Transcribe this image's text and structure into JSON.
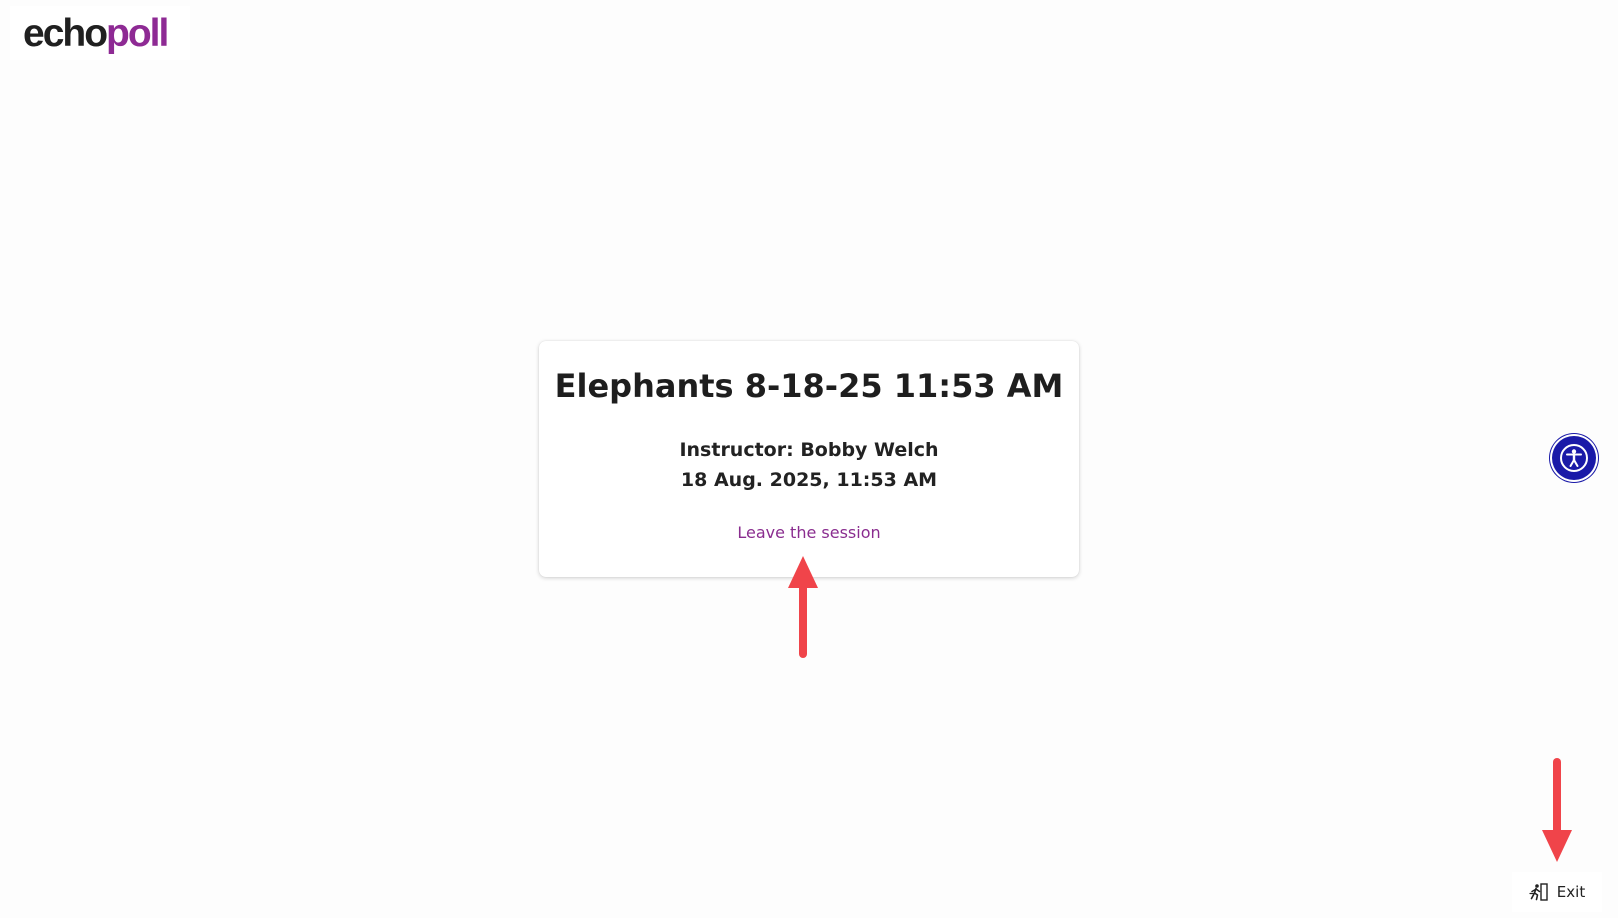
{
  "header": {
    "logo_part1": "echo",
    "logo_part2": "poll"
  },
  "session": {
    "title": "Elephants 8-18-25 11:53 AM",
    "instructor": "Instructor: Bobby Welch",
    "date": "18 Aug. 2025, 11:53 AM",
    "leave_label": "Leave the session"
  },
  "footer": {
    "exit_label": "Exit"
  },
  "icons": {
    "accessibility": "accessibility-icon",
    "exit": "exit-running-person-icon"
  },
  "colors": {
    "brand_purple": "#8e2a94",
    "link_purple": "#8a2d8f",
    "accessibility_blue": "#1a1aa8",
    "annotation_red": "#f0444a"
  }
}
